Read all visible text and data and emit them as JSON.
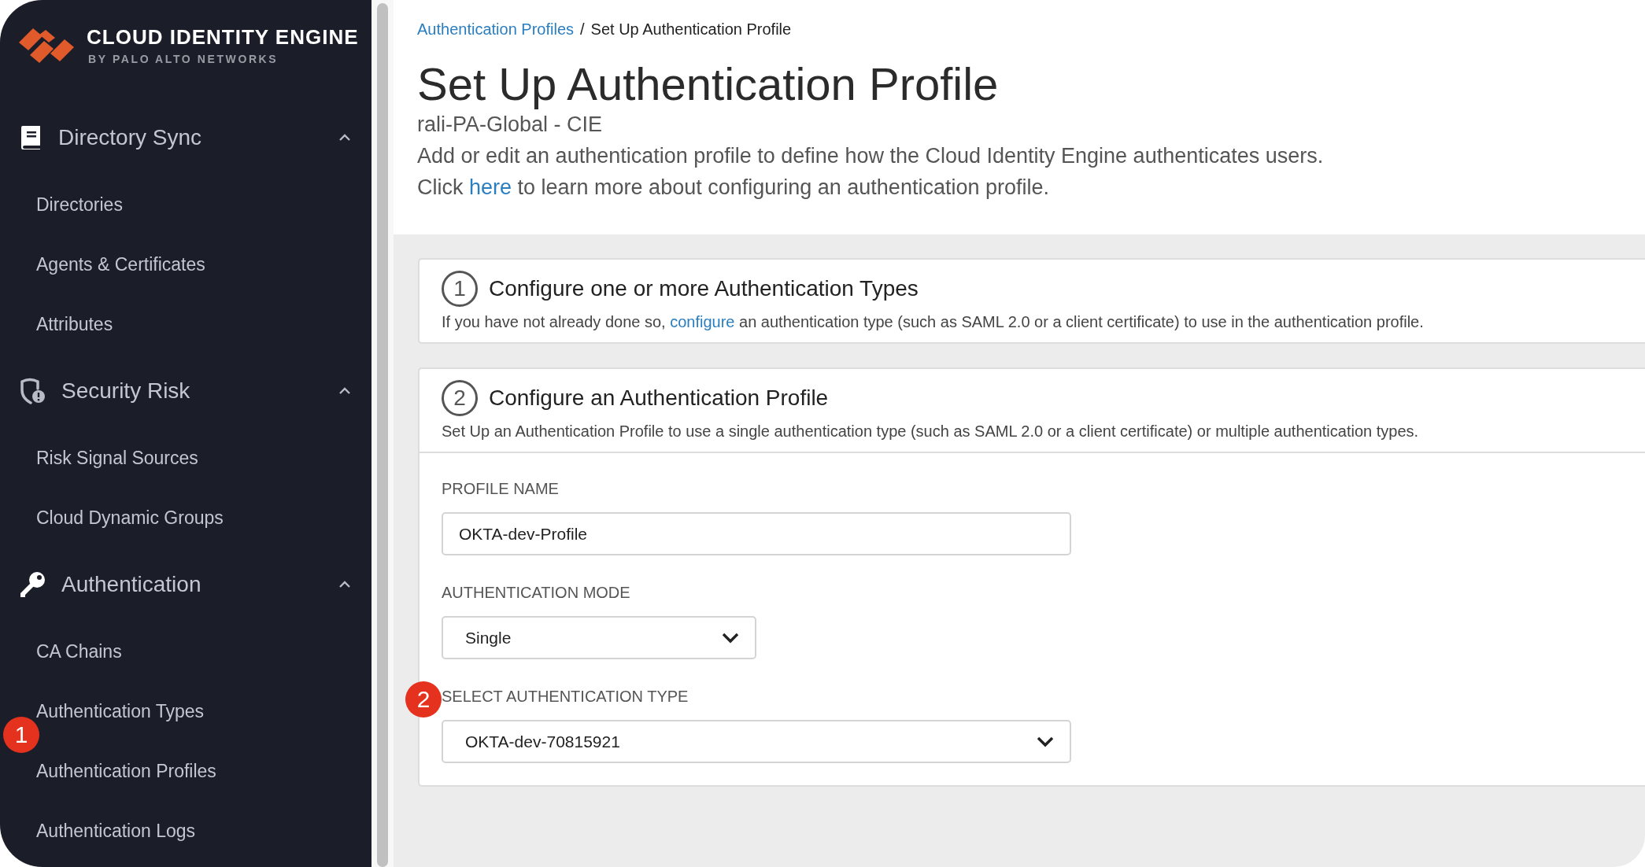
{
  "brand": {
    "name": "CLOUD IDENTITY ENGINE",
    "tagline": "BY PALO ALTO NETWORKS"
  },
  "sidebar": {
    "sections": [
      {
        "label": "Directory Sync",
        "kind": "book",
        "expanded": true,
        "items": [
          {
            "label": "Directories"
          },
          {
            "label": "Agents & Certificates"
          },
          {
            "label": "Attributes"
          }
        ]
      },
      {
        "label": "Security Risk",
        "kind": "shield",
        "expanded": true,
        "items": [
          {
            "label": "Risk Signal Sources"
          },
          {
            "label": "Cloud Dynamic Groups"
          }
        ]
      },
      {
        "label": "Authentication",
        "kind": "key",
        "expanded": true,
        "items": [
          {
            "label": "CA Chains"
          },
          {
            "label": "Authentication Types"
          },
          {
            "label": "Authentication Profiles",
            "marker": "1"
          },
          {
            "label": "Authentication Logs"
          }
        ]
      }
    ]
  },
  "breadcrumb": {
    "link": "Authentication Profiles",
    "separator": "/",
    "current": "Set Up Authentication Profile"
  },
  "header": {
    "title": "Set Up Authentication Profile",
    "subtitle": "rali-PA-Global - CIE",
    "description": "Add or edit an authentication profile to define how the Cloud Identity Engine authenticates users.",
    "help": {
      "before": "Click ",
      "link": "here",
      "after": " to learn more about configuring an authentication profile."
    }
  },
  "steps": [
    {
      "number": "1",
      "title": "Configure one or more Authentication Types",
      "text": {
        "before": "If you have not already done so, ",
        "link": "configure",
        "after": " an authentication type (such as SAML 2.0 or a client certificate) to use in the authentication profile."
      }
    },
    {
      "number": "2",
      "title": "Configure an Authentication Profile",
      "text": {
        "before": "Set Up an Authentication Profile to use a single authentication type (such as SAML 2.0 or a client certificate) or multiple authentication types."
      },
      "fields": [
        {
          "kind": "text",
          "label": "PROFILE NAME",
          "value": "OKTA-dev-Profile"
        },
        {
          "kind": "select",
          "label": "AUTHENTICATION MODE",
          "value": "Single"
        },
        {
          "kind": "select",
          "label": "SELECT AUTHENTICATION TYPE",
          "value": "OKTA-dev-70815921",
          "marker": "2"
        }
      ]
    }
  ]
}
